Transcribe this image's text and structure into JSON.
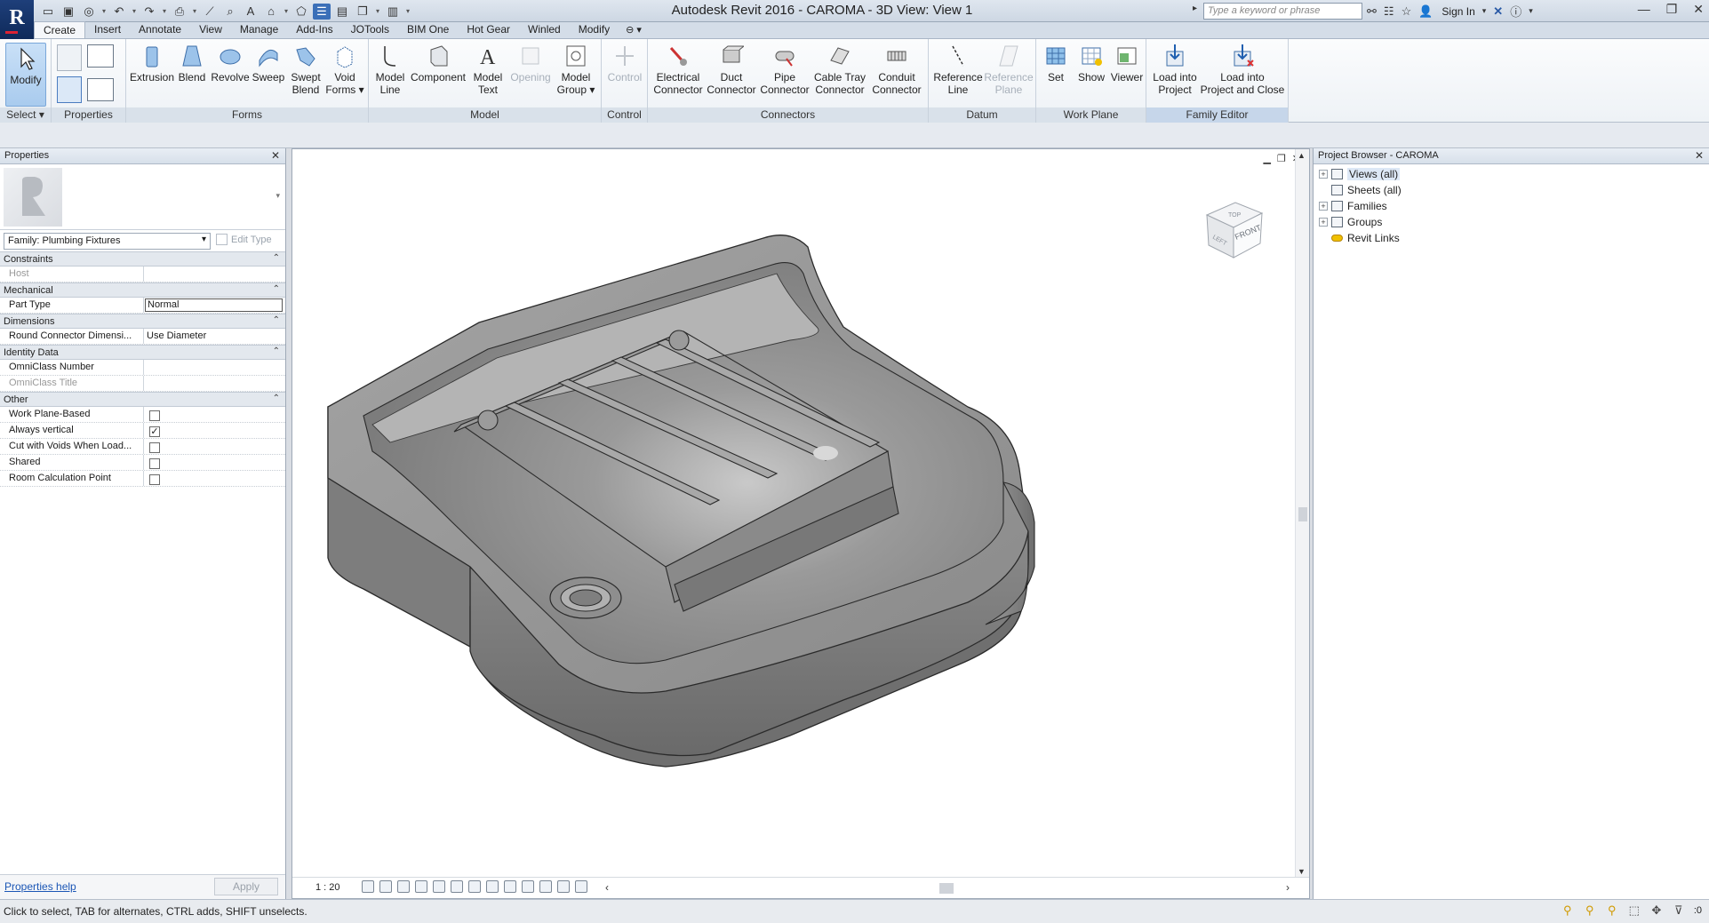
{
  "window": {
    "title": "Autodesk Revit 2016 -     CAROMA - 3D View: View 1",
    "search_placeholder": "Type a keyword or phrase",
    "sign_in": "Sign In"
  },
  "tabs": [
    {
      "label": "Create"
    },
    {
      "label": "Insert"
    },
    {
      "label": "Annotate"
    },
    {
      "label": "View"
    },
    {
      "label": "Manage"
    },
    {
      "label": "Add-Ins"
    },
    {
      "label": "JOTools"
    },
    {
      "label": "BIM One"
    },
    {
      "label": "Hot Gear"
    },
    {
      "label": "Winled"
    },
    {
      "label": "Modify"
    }
  ],
  "ribbon": {
    "select": {
      "modify": "Modify",
      "label": "Select"
    },
    "properties": {
      "label": "Properties"
    },
    "forms": {
      "label": "Forms",
      "extrusion": "Extrusion",
      "blend": "Blend",
      "revolve": "Revolve",
      "sweep": "Sweep",
      "swept_blend_1": "Swept",
      "swept_blend_2": "Blend",
      "void_1": "Void",
      "void_2": "Forms"
    },
    "model": {
      "label": "Model",
      "model_line_1": "Model",
      "model_line_2": "Line",
      "component": "Component",
      "model_text_1": "Model",
      "model_text_2": "Text",
      "opening": "Opening",
      "model_group_1": "Model",
      "model_group_2": "Group"
    },
    "control": {
      "label": "Control",
      "control": "Control"
    },
    "connectors": {
      "label": "Connectors",
      "electrical_1": "Electrical",
      "electrical_2": "Connector",
      "duct_1": "Duct",
      "duct_2": "Connector",
      "pipe_1": "Pipe",
      "pipe_2": "Connector",
      "cabletray_1": "Cable Tray",
      "cabletray_2": "Connector",
      "conduit_1": "Conduit",
      "conduit_2": "Connector"
    },
    "datum": {
      "label": "Datum",
      "refline_1": "Reference",
      "refline_2": "Line",
      "refplane_1": "Reference",
      "refplane_2": "Plane"
    },
    "workplane": {
      "label": "Work Plane",
      "set": "Set",
      "show": "Show",
      "viewer": "Viewer"
    },
    "family_editor": {
      "label": "Family Editor",
      "load_1": "Load into",
      "load_2": "Project",
      "loadclose_1": "Load into",
      "loadclose_2": "Project and Close"
    }
  },
  "properties": {
    "title": "Properties",
    "family_select": "Family: Plumbing Fixtures",
    "edit_type": "Edit Type",
    "groups": [
      {
        "name": "Constraints"
      },
      {
        "name": "Mechanical"
      },
      {
        "name": "Dimensions"
      },
      {
        "name": "Identity Data"
      },
      {
        "name": "Other"
      }
    ],
    "rows": {
      "host": {
        "name": "Host",
        "value": ""
      },
      "part_type": {
        "name": "Part Type",
        "value": "Normal"
      },
      "round_conn": {
        "name": "Round Connector Dimensi...",
        "value": "Use Diameter"
      },
      "omniclass_number": {
        "name": "OmniClass Number",
        "value": ""
      },
      "omniclass_title": {
        "name": "OmniClass Title",
        "value": ""
      },
      "work_plane_based": {
        "name": "Work Plane-Based",
        "checked": false
      },
      "always_vertical": {
        "name": "Always vertical",
        "checked": true
      },
      "cut_with_voids": {
        "name": "Cut with Voids When Load...",
        "checked": false
      },
      "shared": {
        "name": "Shared",
        "checked": false
      },
      "room_calc": {
        "name": "Room Calculation Point",
        "checked": false
      }
    },
    "help": "Properties help",
    "apply": "Apply"
  },
  "viewport": {
    "scale": "1 : 20",
    "viewcube": {
      "top": "TOP",
      "front": "FRONT",
      "left": "LEFT"
    }
  },
  "browser": {
    "title": "Project Browser - CAROMA",
    "items": [
      {
        "label": "Views (all)"
      },
      {
        "label": "Sheets (all)"
      },
      {
        "label": "Families"
      },
      {
        "label": "Groups"
      },
      {
        "label": "Revit Links"
      }
    ]
  },
  "status": {
    "text": "Click to select, TAB for alternates, CTRL adds, SHIFT unselects.",
    "selection_count": ":0"
  },
  "colors": {
    "accent": "#3a6fb8",
    "ribbon_panel_label": "#d9e1ea",
    "model_grey": "#8c8c8c"
  }
}
